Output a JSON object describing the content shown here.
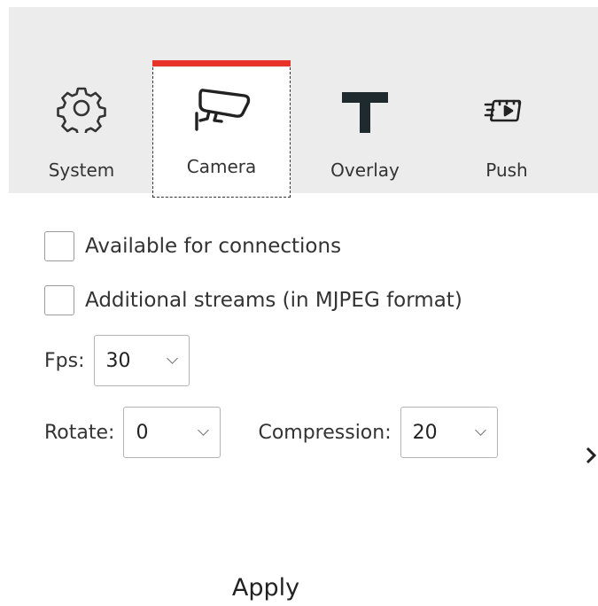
{
  "tabs": [
    {
      "label": "System",
      "icon": "gear-icon"
    },
    {
      "label": "Camera",
      "icon": "security-camera-icon",
      "active": true
    },
    {
      "label": "Overlay",
      "icon": "text-t-icon"
    },
    {
      "label": "Push",
      "icon": "push-video-icon"
    }
  ],
  "accent_color": "#e8332a",
  "options": {
    "available_label": "Available for connections",
    "available_checked": false,
    "mjpeg_label": "Additional streams (in MJPEG format)",
    "mjpeg_checked": false
  },
  "fps": {
    "label": "Fps:",
    "value": "30"
  },
  "rotate": {
    "label": "Rotate:",
    "value": "0"
  },
  "compression": {
    "label": "Compression:",
    "value": "20"
  },
  "apply_label": "Apply"
}
